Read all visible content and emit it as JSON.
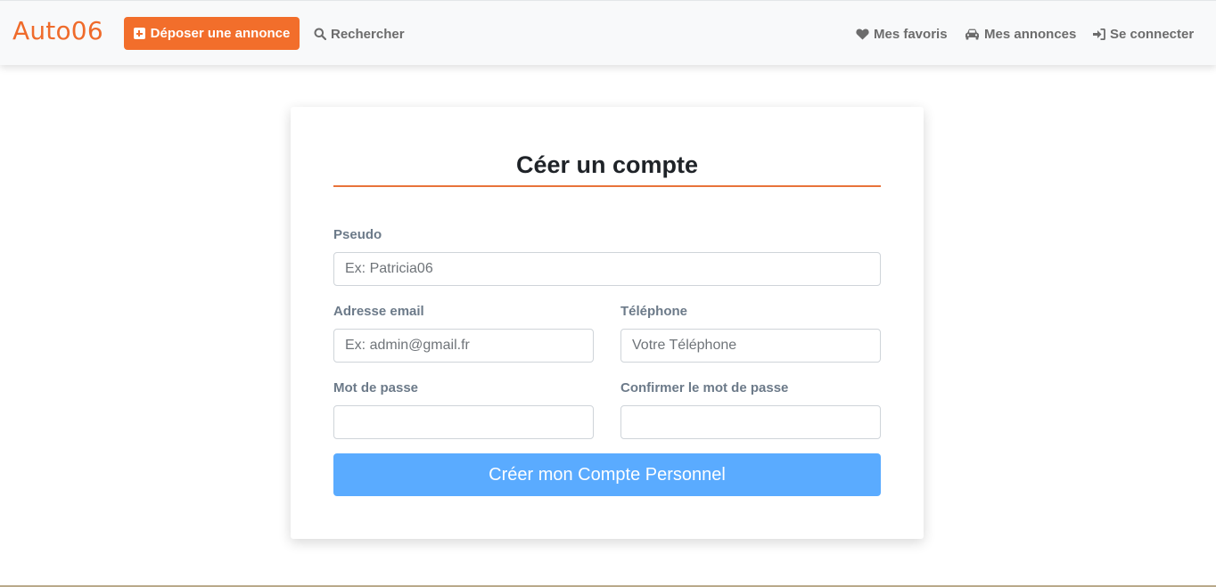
{
  "navbar": {
    "brand": "Auto06",
    "post_ad_label": "Déposer une annonce",
    "search_label": "Rechercher",
    "favorites_label": "Mes favoris",
    "my_ads_label": "Mes annonces",
    "login_label": "Se connecter"
  },
  "form": {
    "title": "Céer un compte",
    "pseudo": {
      "label": "Pseudo",
      "placeholder": "Ex: Patricia06",
      "value": ""
    },
    "email": {
      "label": "Adresse email",
      "placeholder": "Ex: admin@gmail.fr",
      "value": ""
    },
    "phone": {
      "label": "Téléphone",
      "placeholder": "Votre Téléphone",
      "value": ""
    },
    "password": {
      "label": "Mot de passe",
      "value": ""
    },
    "confirm_password": {
      "label": "Confirmer le mot de passe",
      "value": ""
    },
    "submit_label": "Créer mon Compte Personnel"
  },
  "colors": {
    "accent": "#f26e2b",
    "submit": "#5aabff",
    "label": "#6c7a89"
  }
}
